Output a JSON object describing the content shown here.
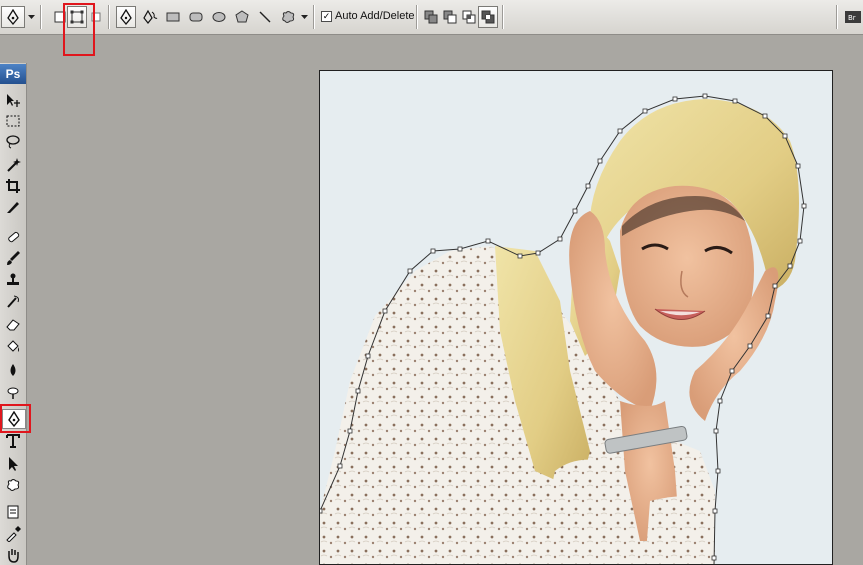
{
  "app": {
    "logo": "Ps"
  },
  "options_bar": {
    "auto_add_delete_label": "Auto Add/Delete",
    "auto_add_delete_checked": "✓",
    "tool_modes": [
      "shape-layers-icon",
      "paths-icon",
      "fill-pixels-icon"
    ],
    "shape_tools": [
      "pen-icon",
      "freeform-pen-icon",
      "rectangle-icon",
      "rounded-rectangle-icon",
      "ellipse-icon",
      "polygon-icon",
      "line-icon",
      "custom-shape-icon"
    ],
    "path_ops": [
      "add-to-path-icon",
      "subtract-from-path-icon",
      "intersect-path-icon",
      "exclude-overlap-icon"
    ]
  },
  "toolbox": {
    "tools": [
      "move-icon",
      "marquee-icon",
      "lasso-icon",
      "magic-wand-icon",
      "crop-icon",
      "slice-icon",
      "healing-brush-icon",
      "brush-icon",
      "clone-stamp-icon",
      "history-brush-icon",
      "eraser-icon",
      "paint-bucket-icon",
      "blur-icon",
      "dodge-icon",
      "pen-icon",
      "type-icon",
      "path-selection-icon",
      "custom-shape-icon",
      "notes-icon",
      "eyedropper-icon",
      "hand-icon"
    ],
    "selected": "pen-icon"
  },
  "highlight_color": "#e0161d",
  "canvas": {
    "background": "#e6edf0",
    "path_color": "#333333"
  }
}
